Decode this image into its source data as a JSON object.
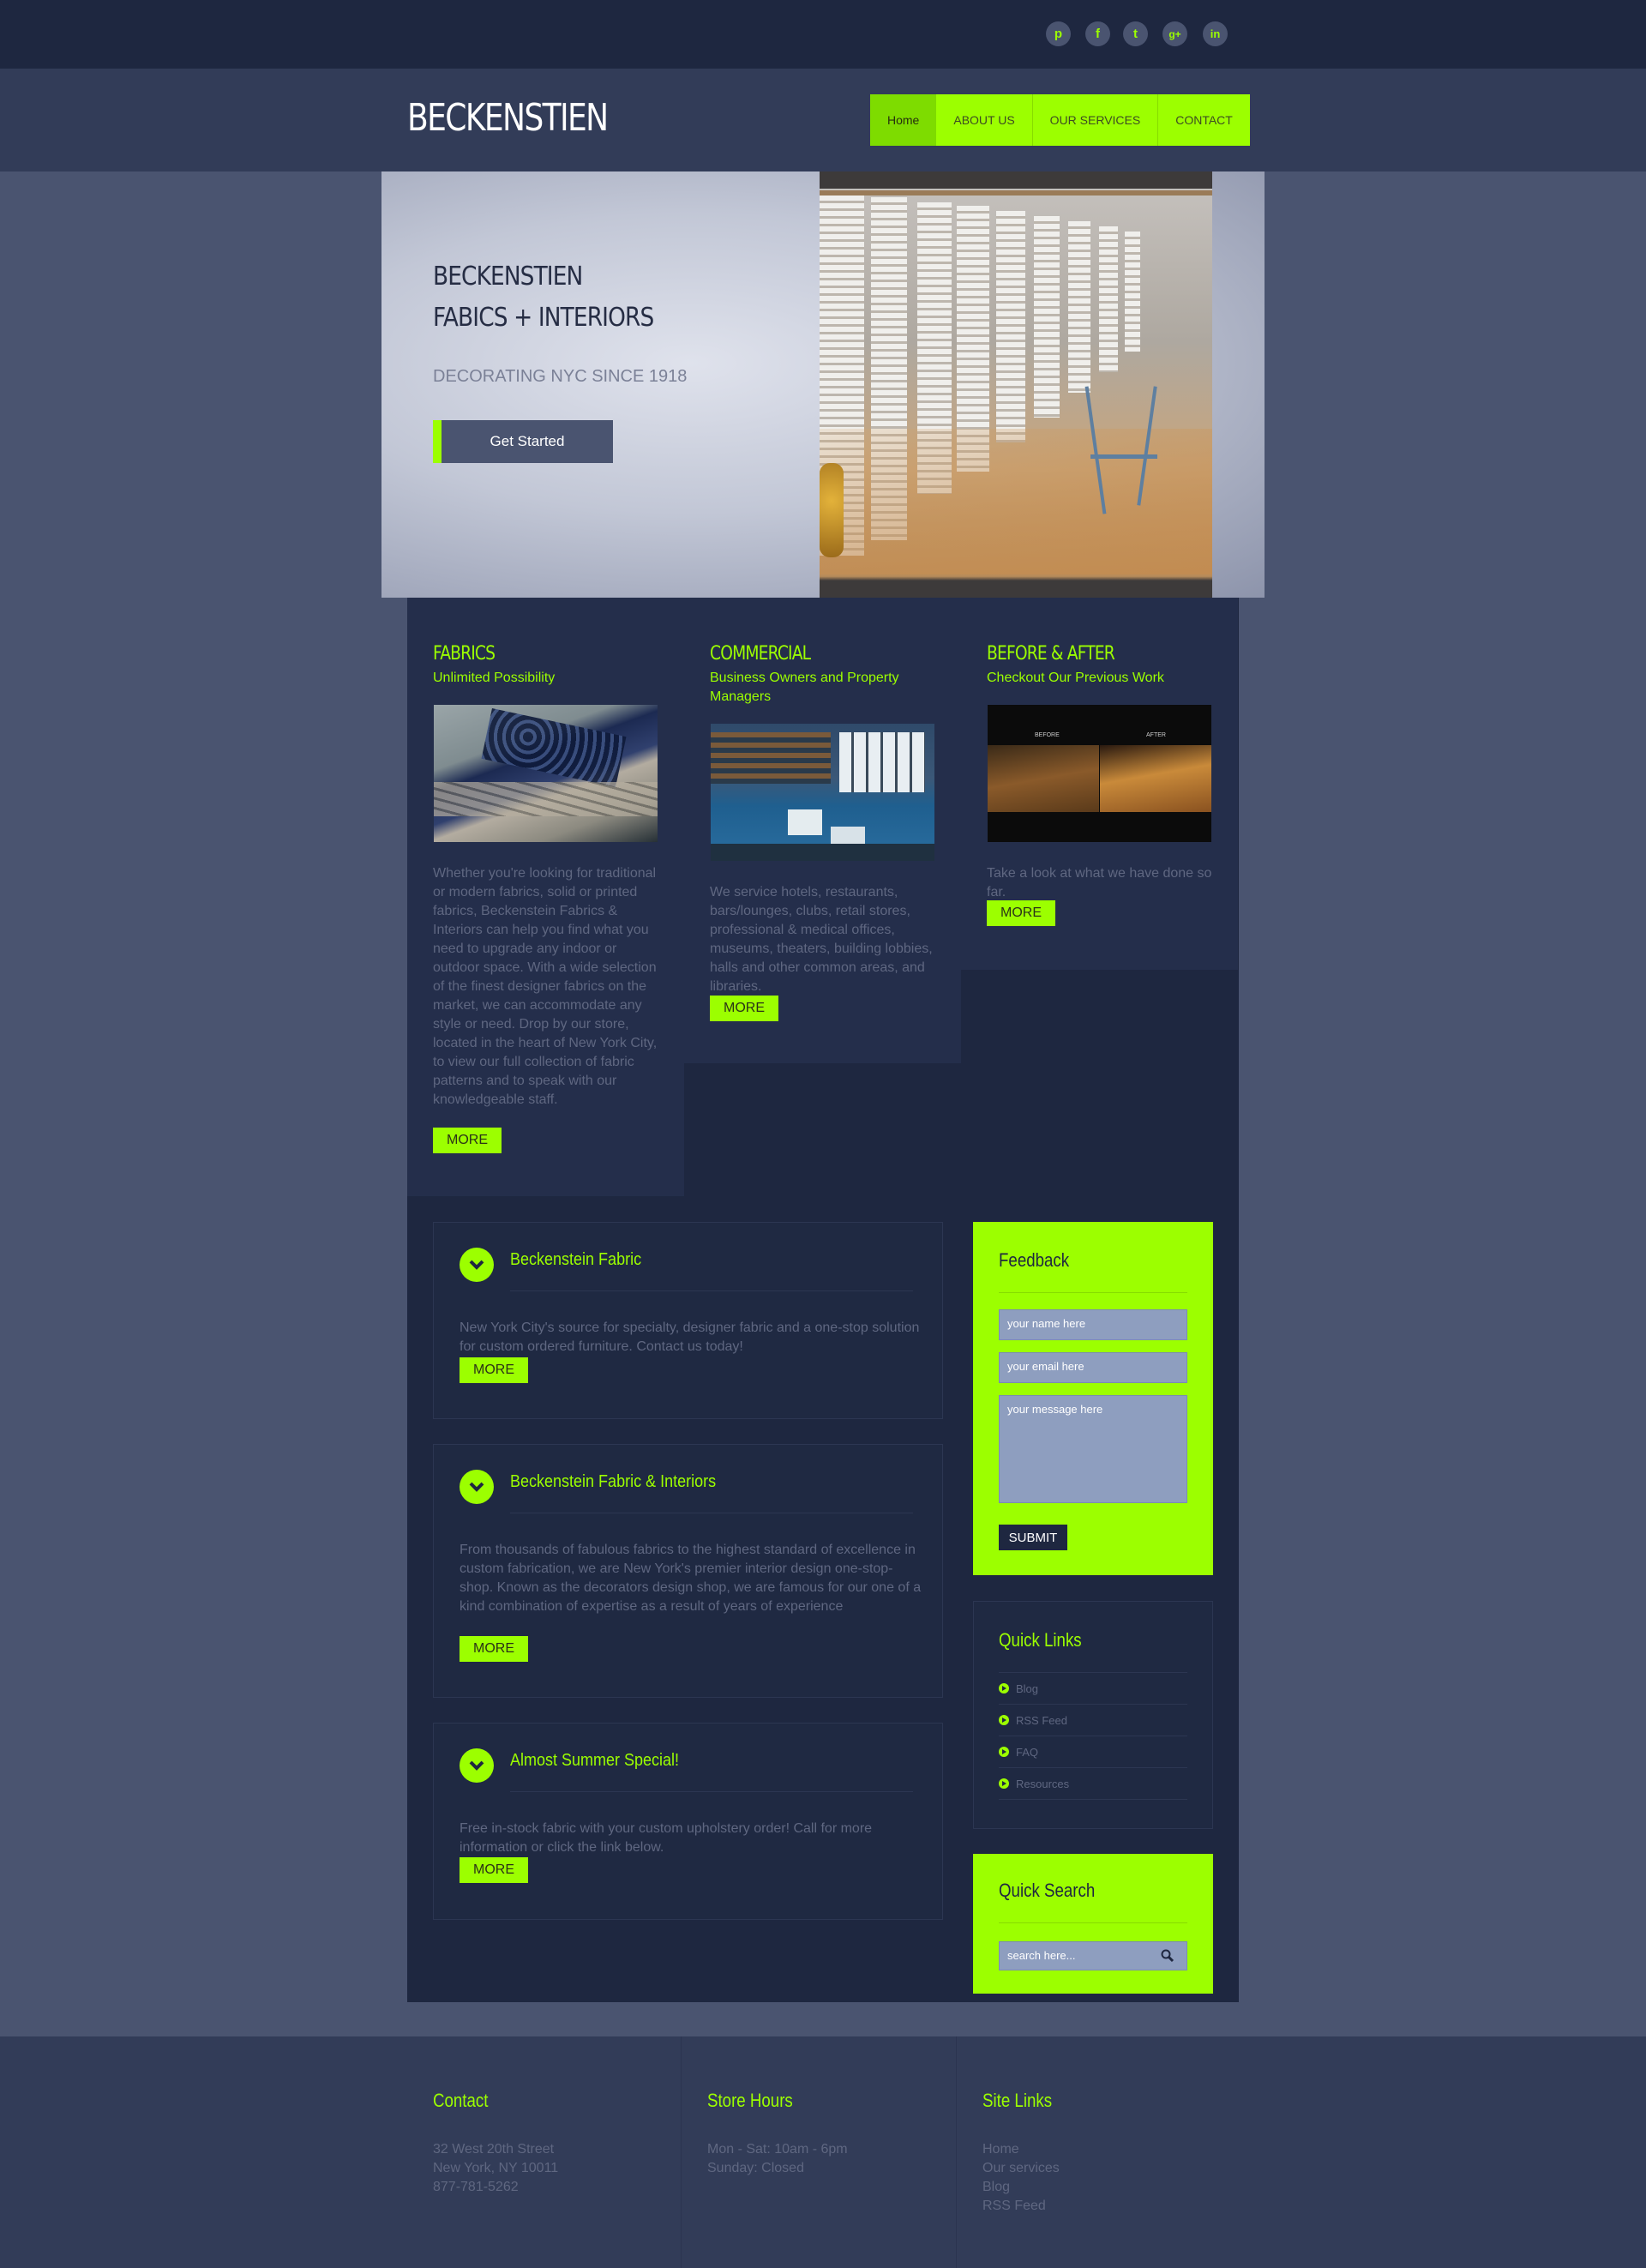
{
  "social": {
    "icons": [
      "pinterest-icon",
      "facebook-icon",
      "twitter-icon",
      "google-plus-icon",
      "linkedin-icon"
    ],
    "glyphs": [
      "p",
      "f",
      "t",
      "g+",
      "in"
    ]
  },
  "header": {
    "logo": "BECKENSTIEN",
    "nav": [
      "Home",
      "ABOUT US",
      "OUR SERVICES",
      "CONTACT"
    ]
  },
  "hero": {
    "title_line1": "BECKENSTIEN",
    "title_line2": "FABICS + INTERIORS",
    "subtitle": "DECORATING NYC SINCE 1918",
    "button": "Get Started"
  },
  "columns": [
    {
      "title": "FABRICS",
      "subtitle": "Unlimited Possibility",
      "text": "Whether you're looking for traditional or modern fabrics, solid or printed fabrics, Beckenstein Fabrics & Interiors can help you find what you need to upgrade any indoor or outdoor space. With a wide selection of the finest designer fabrics on the market, we can accommodate any style or need. Drop by our store, located in the heart of New York City, to view our full collection of fabric patterns and to speak with our knowledgeable staff.",
      "more": "MORE"
    },
    {
      "title": "COMMERCIAL",
      "subtitle": "Business Owners and Property Managers",
      "text": "We service hotels, restaurants, bars/lounges, clubs, retail stores, professional & medical offices, museums, theaters, building lobbies, halls and other common areas, and libraries.",
      "more": "MORE"
    },
    {
      "title": "BEFORE & AFTER",
      "subtitle": "Checkout Our Previous Work",
      "text": "Take a look at what we have done so far.",
      "more": "MORE",
      "before_label": "BEFORE",
      "after_label": "AFTER"
    }
  ],
  "panels": [
    {
      "title": "Beckenstein Fabric",
      "text": "New York City's source for specialty, designer fabric and a one-stop solution for custom ordered furniture. Contact us today!",
      "more": "MORE"
    },
    {
      "title": "Beckenstein Fabric & Interiors",
      "text": "From thousands of fabulous fabrics to the highest standard of excellence in custom fabrication, we are New York's premier interior design one-stop-shop. Known as the decorators design shop, we are famous for our one of a kind combination of expertise as a result of years of experience",
      "more": "MORE"
    },
    {
      "title": "Almost Summer Special!",
      "text": "Free in-stock fabric with your custom upholstery order! Call for more information or click the link below.",
      "more": "MORE"
    }
  ],
  "feedback": {
    "title": "Feedback",
    "name_placeholder": "your name here",
    "email_placeholder": "your email  here",
    "message_placeholder": "your message  here",
    "submit": "SUBMIT"
  },
  "quick_links": {
    "title": "Quick Links",
    "items": [
      "Blog",
      "RSS Feed",
      "FAQ",
      "Resources"
    ]
  },
  "quick_search": {
    "title": "Quick Search",
    "placeholder": "search here..."
  },
  "footer": {
    "contact": {
      "title": "Contact",
      "lines": [
        "32 West 20th Street",
        "New York, NY 10011",
        "877-781-5262"
      ]
    },
    "hours": {
      "title": "Store Hours",
      "lines": [
        "Mon - Sat: 10am - 6pm",
        "Sunday: Closed"
      ]
    },
    "links": {
      "title": "Site Links",
      "items": [
        "Home",
        "Our services",
        "Blog",
        "RSS Feed"
      ]
    }
  },
  "colors": {
    "accent": "#9cff00",
    "dark": "#1e2740",
    "header": "#323c58",
    "page": "#4a5470"
  }
}
